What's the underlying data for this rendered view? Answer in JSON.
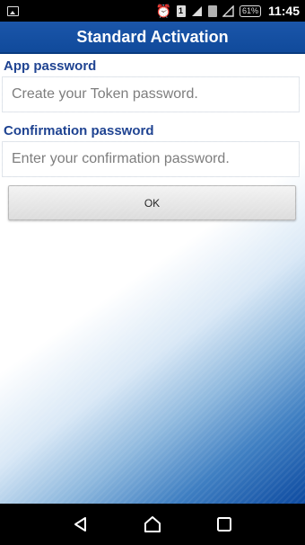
{
  "status_bar": {
    "battery": "61%",
    "sim_label": "1",
    "time": "11:45"
  },
  "header": {
    "title": "Standard Activation"
  },
  "form": {
    "app_password_label": "App password",
    "app_password_placeholder": "Create your Token password.",
    "app_password_value": "",
    "confirm_label": "Confirmation password",
    "confirm_placeholder": "Enter your confirmation password.",
    "confirm_value": "",
    "ok_label": "OK"
  },
  "nav": {
    "back_icon": "back-icon",
    "home_icon": "home-icon",
    "recents_icon": "recents-icon"
  },
  "colors": {
    "header_blue": "#1b56aa",
    "label_blue": "#1a3f8f"
  }
}
